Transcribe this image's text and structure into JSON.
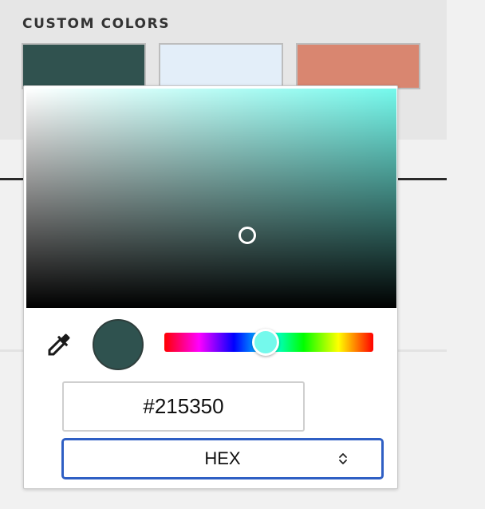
{
  "custom_colors": {
    "title": "CUSTOM COLORS",
    "swatches": [
      {
        "name": "swatch-dark-teal",
        "color": "#30524f"
      },
      {
        "name": "swatch-pale-blue",
        "color": "#e3eef9"
      },
      {
        "name": "swatch-salmon",
        "color": "#d98670"
      }
    ]
  },
  "picker": {
    "base_hue_color": "#74f9ec",
    "selected_color": "#2f524f",
    "hue_value": 174,
    "hex_value": "#215350",
    "format": {
      "label": "HEX"
    }
  },
  "icons": {
    "eyedropper": "eyedropper-icon",
    "select_arrows": "up-down-chevron-icon"
  }
}
